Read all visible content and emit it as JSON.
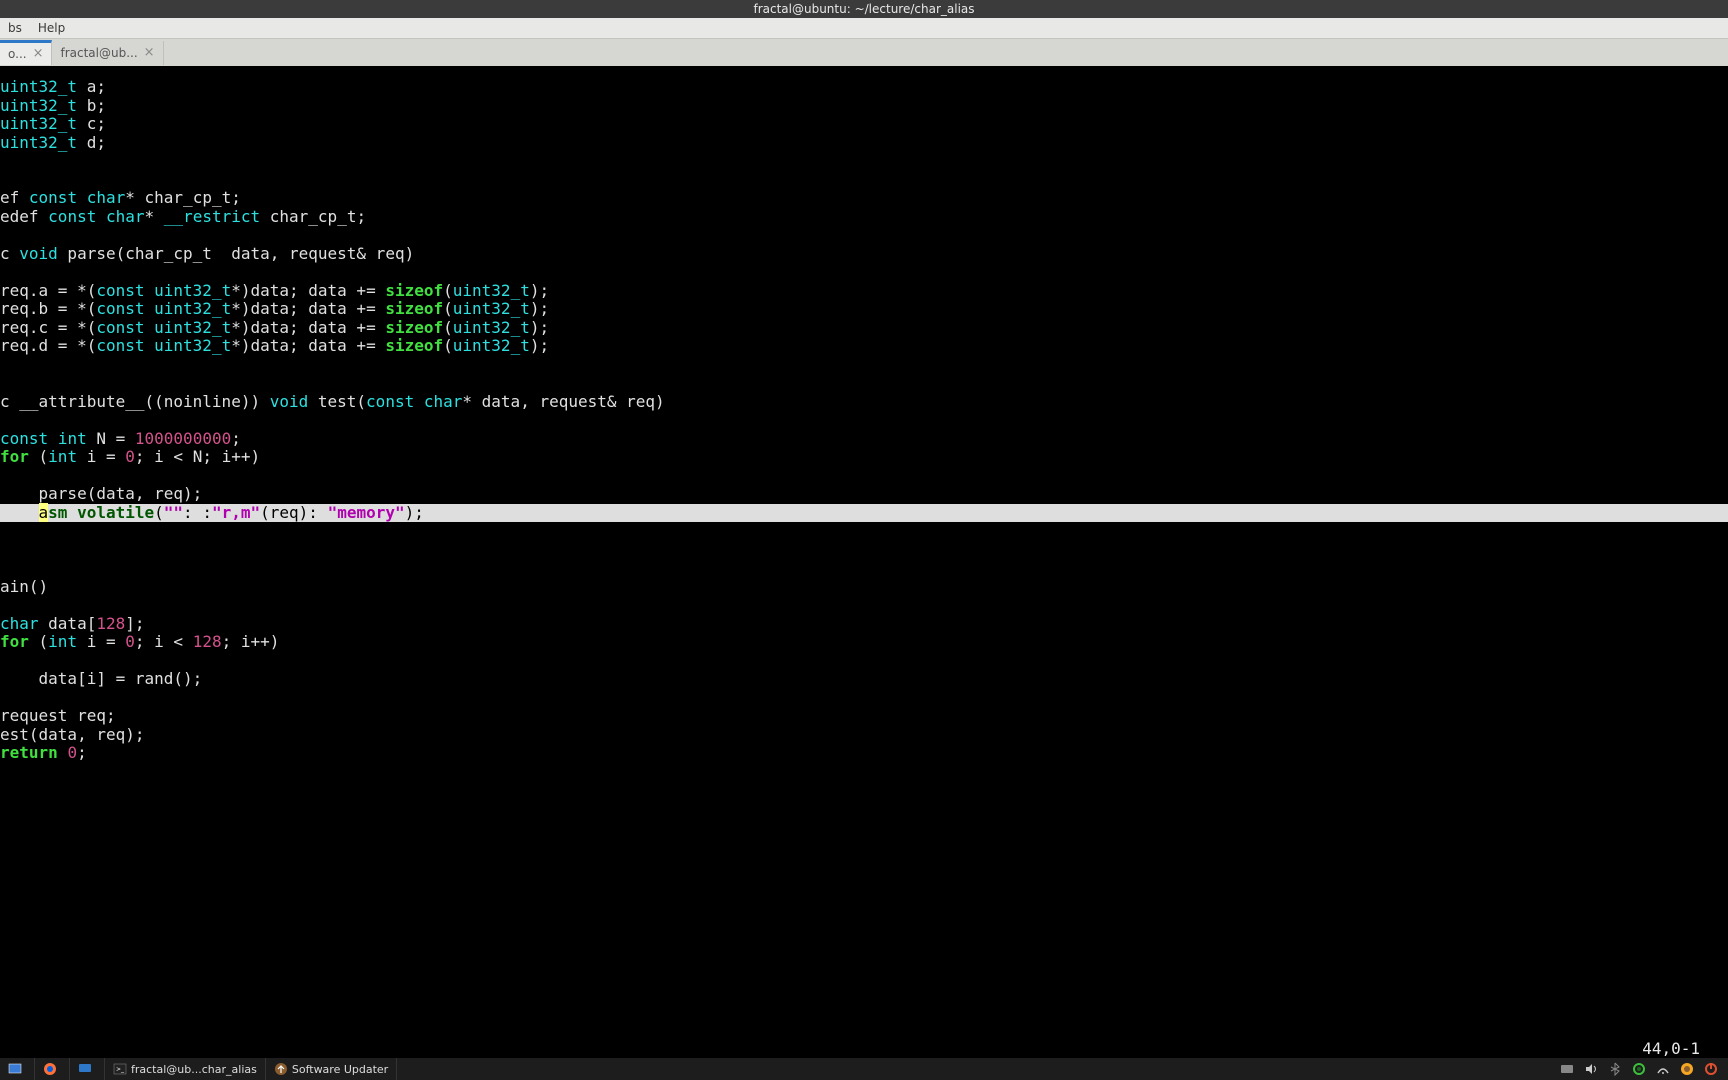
{
  "titlebar": {
    "title": "fractal@ubuntu: ~/lecture/char_alias"
  },
  "menubar": {
    "tabs": "bs",
    "help": "Help"
  },
  "tabs": {
    "active_label": "o...",
    "inactive_label": "fractal@ub...",
    "close": "×"
  },
  "code": {
    "l01": "uint32_t a;",
    "l02": "uint32_t b;",
    "l03": "uint32_t c;",
    "l04": "uint32_t d;",
    "typedef1_pre": "ef ",
    "typedef2_pre": "edef ",
    "const": "const",
    "char": "char",
    "star": "*",
    "char_cp_t": " char_cp_t;",
    "restrict": "__restrict",
    "void": "void",
    "parse": " parse(char_cp_t  data, request& req)",
    "reqa": "req.a = *(",
    "reqb": "req.b = *(",
    "reqc": "req.c = *(",
    "reqd": "req.d = *(",
    "u32": "uint32_t",
    "cast_mid": "*)data; data += ",
    "sizeof": "sizeof",
    "sizeof_arg": "(",
    "sizeof_end": ");",
    "attr_pre": "c __attribute__((noinline)) ",
    "test_sig": " test(",
    "test_mid": "* data, request& req)",
    "constint": "const",
    "int": "int",
    "N_eq": " N = ",
    "N_val": "1000000000",
    "semi": ";",
    "for": "for",
    "for_open": " (",
    "for_body": " i = ",
    "zero": "0",
    "for_cond": "; i < N; i++)",
    "parsecall": "    parse(data, req);",
    "asm_indent": "    ",
    "asm": "asm",
    "volatile": " volatile",
    "asm_open": "(",
    "empty_str": "\"\"",
    "asm_col": ": :",
    "rm_str": "\"r,m\"",
    "asm_req": "(req): ",
    "mem_str": "\"memory\"",
    "asm_close": ");",
    "main": "ain()",
    "char_kw": "char",
    "data_decl": " data[",
    "n128": "128",
    "close_br": "];",
    "for2_cond": "; i < ",
    "for2_end": "; i++)",
    "dataassign": "    data[i] = rand();",
    "reqdecl": "request req;",
    "testcall": "est(data, req);",
    "return": "return",
    "ret0": " ",
    "ret_semi": ";",
    "cursor_a": "a"
  },
  "status": {
    "pos": "44,0-1"
  },
  "taskbar": {
    "window1": "fractal@ub...char_alias",
    "window2": "Software Updater"
  },
  "chart_data": null
}
